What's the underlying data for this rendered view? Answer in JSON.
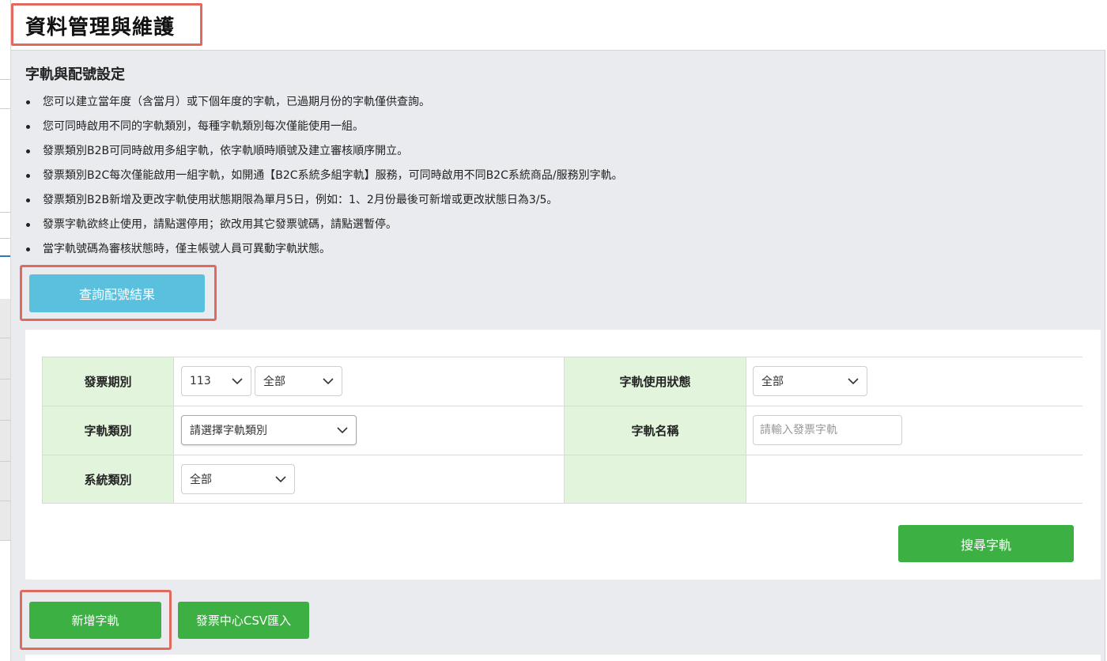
{
  "header": {
    "title": "資料管理與維護"
  },
  "section": {
    "title": "字軌與配號設定",
    "notes": [
      "您可以建立當年度（含當月）或下個年度的字軌，已過期月份的字軌僅供查詢。",
      "您可同時啟用不同的字軌類別，每種字軌類別每次僅能使用一組。",
      "發票類別B2B可同時啟用多組字軌，依字軌順時順號及建立審核順序開立。",
      "發票類別B2C每次僅能啟用一組字軌，如開通【B2C系統多組字軌】服務，可同時啟用不同B2C系統商品/服務別字軌。",
      "發票類別B2B新增及更改字軌使用狀態期限為單月5日，例如：1、2月份最後可新增或更改狀態日為3/5。",
      "發票字軌欲終止使用，請點選停用；欲改用其它發票號碼，請點選暫停。",
      "當字軌號碼為審核狀態時，僅主帳號人員可異動字軌狀態。"
    ]
  },
  "buttons": {
    "query_result": "查詢配號結果",
    "search": "搜尋字軌",
    "add": "新增字軌",
    "csv_import": "發票中心CSV匯入"
  },
  "form": {
    "invoice_period": {
      "label": "發票期別",
      "year": "113",
      "period": "全部"
    },
    "usage_status": {
      "label": "字軌使用狀態",
      "value": "全部"
    },
    "track_type": {
      "label": "字軌類別",
      "value": "請選擇字軌類別"
    },
    "track_name": {
      "label": "字軌名稱",
      "placeholder": "請輸入發票字軌"
    },
    "system_type": {
      "label": "系統類別",
      "value": "全部"
    }
  },
  "colors": {
    "highlight": "#e06a5e",
    "info_button": "#5bc0de",
    "success_button": "#3cb043",
    "label_cell": "#e2f5dc",
    "page_background": "#e9ebee"
  },
  "icons": {
    "select_arrow": "chevron-down-icon"
  }
}
